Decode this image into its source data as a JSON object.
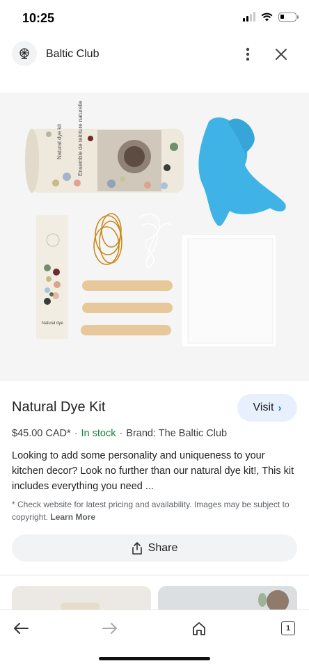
{
  "status_bar": {
    "time": "10:25"
  },
  "header": {
    "site_name": "Baltic Club",
    "logo_icon": "globe-plant-logo",
    "more_icon": "more-vert-icon",
    "close_icon": "close-icon"
  },
  "product_image": {
    "tube_text_1": "Natural dye kit",
    "tube_text_2": "Ensemble de teinture naturelle",
    "card_text": "Natural dye"
  },
  "product": {
    "title": "Natural Dye Kit",
    "visit_label": "Visit",
    "price": "$45.00 CAD*",
    "stock": "In stock",
    "brand": "Brand: The Baltic Club",
    "description": "Looking to add some personality and uniqueness to your kitchen decor? Look no further than our natural dye kit!, This kit includes everything you need ...",
    "disclaimer": "* Check website for latest pricing and availability. Images may be subject to copyright.",
    "learn_more": "Learn More",
    "share_label": "Share"
  },
  "bottom_nav": {
    "tab_count": "1",
    "icons": [
      "back-arrow-icon",
      "forward-arrow-icon",
      "home-icon",
      "tabs-icon"
    ]
  },
  "colors": {
    "in_stock": "#188038",
    "visit_bg": "#e8f0fe",
    "accent": "#1a73e8",
    "glove": "#3fb3e6"
  }
}
